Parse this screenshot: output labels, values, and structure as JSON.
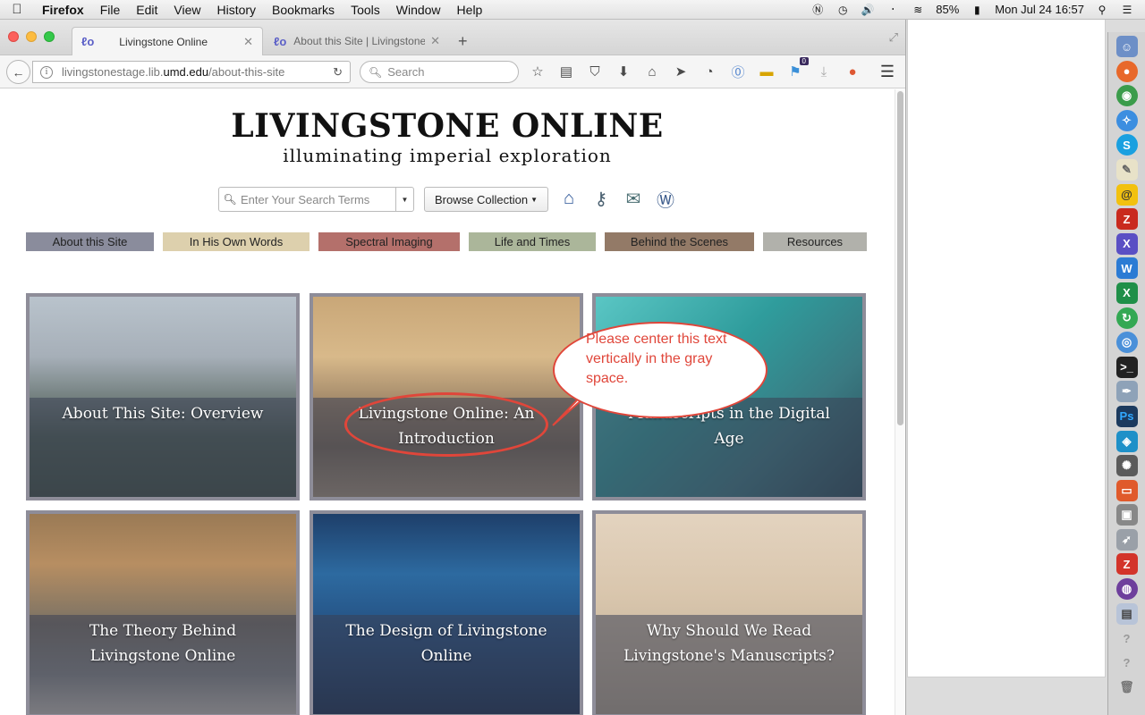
{
  "menubar": {
    "app": "Firefox",
    "items": [
      "File",
      "Edit",
      "View",
      "History",
      "Bookmarks",
      "Tools",
      "Window",
      "Help"
    ],
    "battery": "85%",
    "datetime": "Mon Jul 24  16:57"
  },
  "browser": {
    "tabs": [
      {
        "title": "Livingstone Online",
        "active": true
      },
      {
        "title": "About this Site | Livingstone",
        "active": false
      }
    ],
    "url_prefix": "livingstonestage.lib.",
    "url_host": "umd.edu",
    "url_path": "/about-this-site",
    "search_placeholder": "Search",
    "badge_count": "0"
  },
  "site": {
    "title": "LIVINGSTONE ONLINE",
    "tagline": "illuminating imperial exploration",
    "search_placeholder": "Enter Your Search Terms",
    "browse_label": "Browse Collection",
    "categories": [
      {
        "label": "About this Site",
        "color": "#8a8c9c"
      },
      {
        "label": "In His Own Words",
        "color": "#ddd0ad"
      },
      {
        "label": "Spectral Imaging",
        "color": "#b4706b"
      },
      {
        "label": "Life and Times",
        "color": "#abb69a"
      },
      {
        "label": "Behind the Scenes",
        "color": "#937a67"
      },
      {
        "label": "Resources",
        "color": "#b1b1ab"
      }
    ],
    "tiles": [
      {
        "caption": "About This Site: Overview"
      },
      {
        "caption": "Livingstone Online: An Introduction"
      },
      {
        "caption": "Manuscripts in the Digital Age"
      },
      {
        "caption": "The Theory Behind Livingstone Online"
      },
      {
        "caption": "The Design of Livingstone Online"
      },
      {
        "caption": "Why Should We Read Livingstone's Manuscripts?"
      }
    ]
  },
  "annotation": {
    "text": "Please center this text vertically in the gray space.",
    "color": "#e0463a"
  }
}
